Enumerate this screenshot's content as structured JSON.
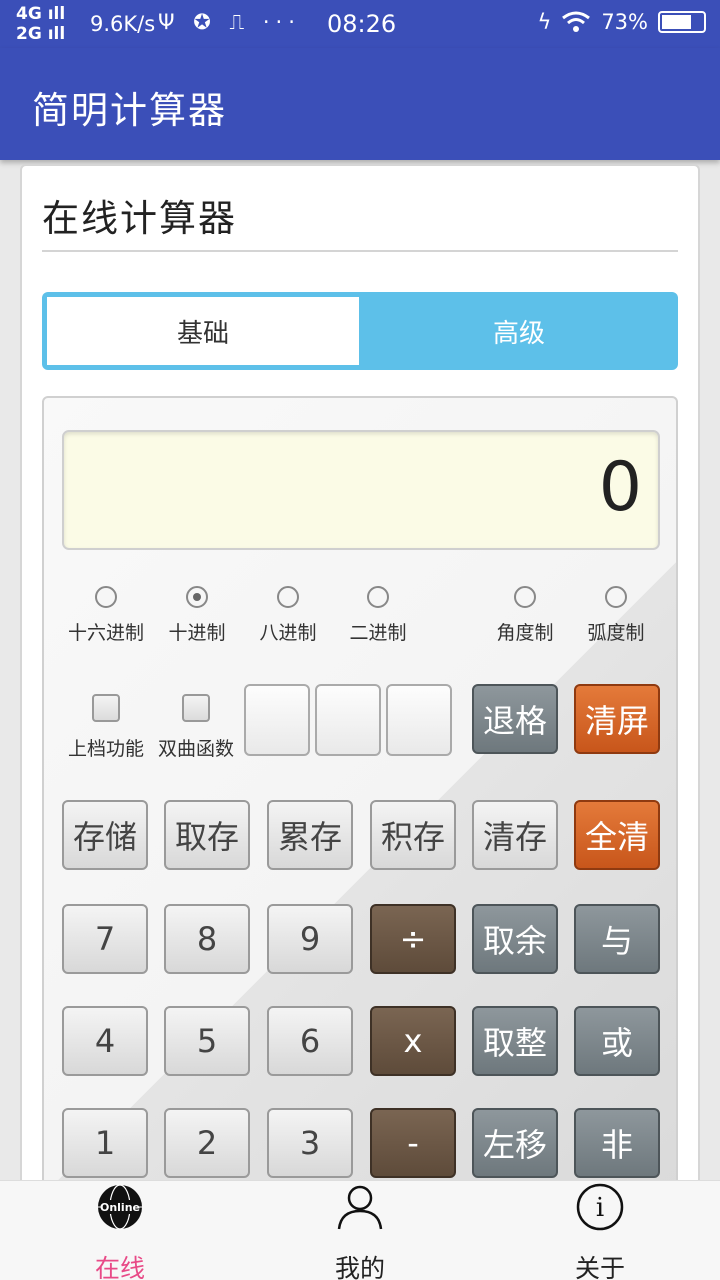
{
  "status_bar": {
    "network_top": "4G",
    "network_bottom": "2G",
    "speed": "9.6K/s",
    "icons": "Ψ ✪ ⎍ ···",
    "time": "08:26",
    "battery_percent": "73%",
    "battery_level": 0.73
  },
  "app": {
    "title": "简明计算器"
  },
  "card": {
    "title": "在线计算器"
  },
  "tabs": [
    {
      "label": "基础",
      "selected": true
    },
    {
      "label": "高级",
      "selected": false
    }
  ],
  "display": {
    "value": "0"
  },
  "radix": [
    {
      "label": "十六进制",
      "checked": false
    },
    {
      "label": "十进制",
      "checked": true
    },
    {
      "label": "八进制",
      "checked": false
    },
    {
      "label": "二进制",
      "checked": false
    }
  ],
  "angle": [
    {
      "label": "角度制",
      "checked": false
    },
    {
      "label": "弧度制",
      "checked": false
    }
  ],
  "toggles": [
    {
      "label": "上档功能",
      "checked": false
    },
    {
      "label": "双曲函数",
      "checked": false
    }
  ],
  "keys": {
    "backspace": "退格",
    "clear_screen": "清屏",
    "store": "存储",
    "recall": "取存",
    "mem_add": "累存",
    "mem_mul": "积存",
    "mem_clear": "清存",
    "all_clear": "全清",
    "n7": "7",
    "n8": "8",
    "n9": "9",
    "div": "÷",
    "mod": "取余",
    "and": "与",
    "n4": "4",
    "n5": "5",
    "n6": "6",
    "mul": "x",
    "int": "取整",
    "or": "或",
    "n1": "1",
    "n2": "2",
    "n3": "3",
    "sub": "-",
    "lshift": "左移",
    "not": "非"
  },
  "colors": {
    "primary": "#3b4fb8",
    "tab_accent": "#5dc0e9",
    "nav_active": "#e84a87",
    "display_bg": "#fbfbe6",
    "key_orange": "#d9642a",
    "key_brown": "#6b5644",
    "key_gray": "#7e878c"
  },
  "bottom_nav": [
    {
      "label": "在线",
      "icon": "globe-online-icon",
      "icon_text": "Online",
      "active": true
    },
    {
      "label": "我的",
      "icon": "user-icon",
      "active": false
    },
    {
      "label": "关于",
      "icon": "info-icon",
      "icon_text": "i",
      "active": false
    }
  ]
}
